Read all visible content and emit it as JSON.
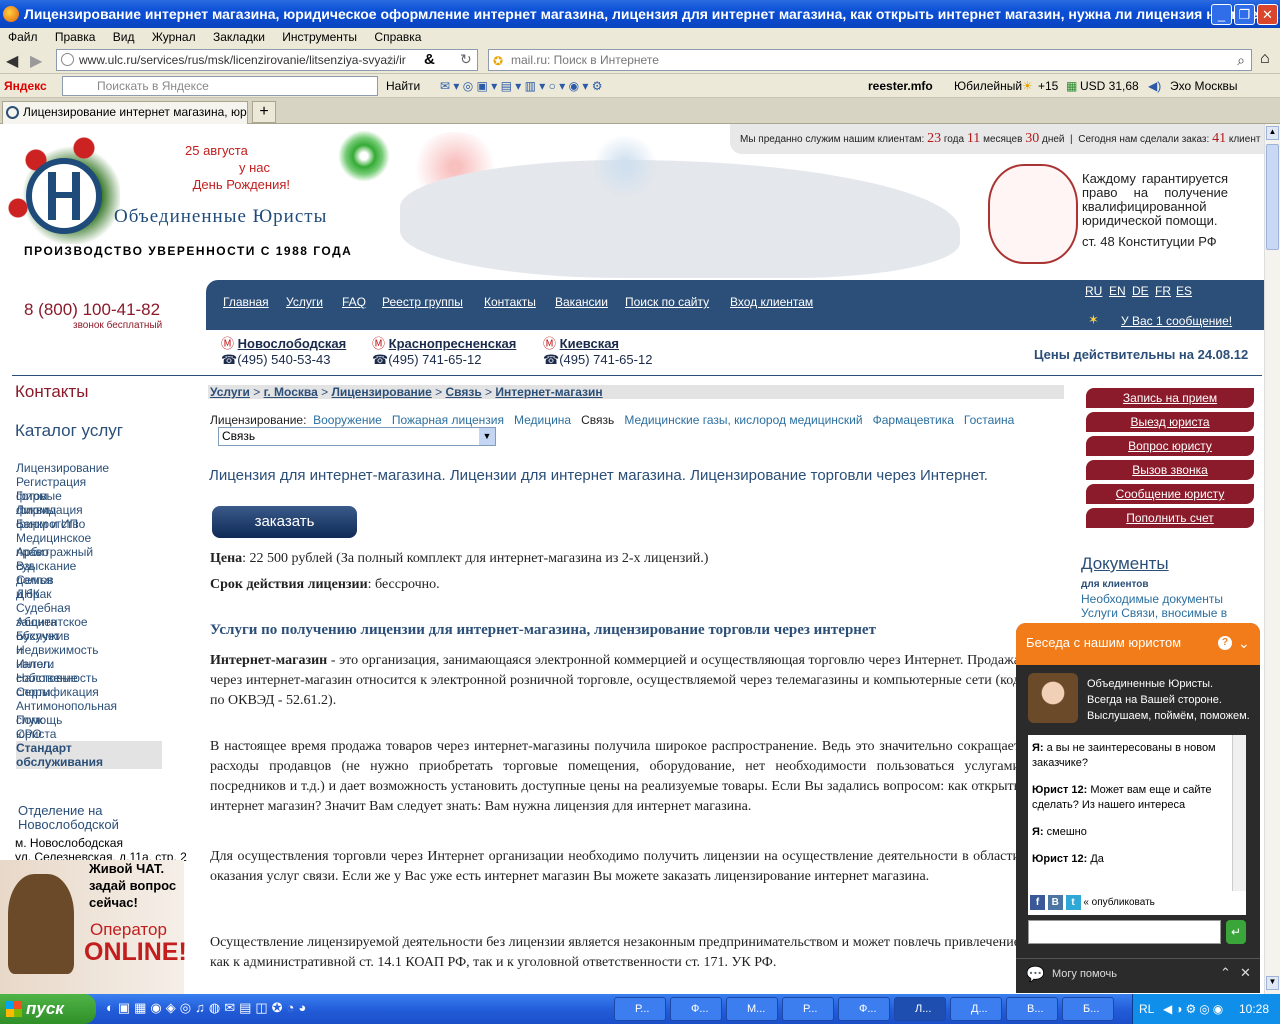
{
  "window": {
    "title": "Лицензирование интернет магазина, юридическое оформление интернет магазина, лицензия для интернет магазина, как открыть интернет магазин, нужна ли лицензия на интерн..."
  },
  "menu": [
    "Файл",
    "Правка",
    "Вид",
    "Журнал",
    "Закладки",
    "Инструменты",
    "Справка"
  ],
  "address": {
    "url": "www.ulc.ru/services/rus/msk/licenzirovanie/litsenziya-svyazi/ir",
    "search_placeholder": "mail.ru: Поиск в Интернете"
  },
  "yandex": {
    "logo": "Яндекс",
    "search_placeholder": "Поискать в Яндексе",
    "find": "Найти",
    "reester": "reester.mfo",
    "city": "Юбилейный",
    "weather": "+15",
    "usd": "USD 31,68",
    "radio": "Эхо Москвы"
  },
  "tab": {
    "title": "Лицензирование интернет магазина, юри..."
  },
  "header": {
    "birthday_line1": "25 августа",
    "birthday_line2": "у нас",
    "birthday_line3": "День Рождения!",
    "company": "Объединенные Юристы",
    "slogan": "ПРОИЗВОДСТВО УВЕРЕННОСТИ С 1988 ГОДА",
    "guarantee": "Каждому гарантируется право на получение квалифицированной юридической помощи.",
    "constitution": "ст. 48 Конституции РФ",
    "serve_text": "Мы преданно служим нашим клиентам:",
    "years": "23",
    "years_label": "года",
    "months": "11",
    "months_label": "месяцев",
    "days": "30",
    "days_label": "дней",
    "orders_text": "Сегодня нам сделали заказ:",
    "orders": "41",
    "orders_label": "клиент",
    "phone": "8 (800) 100-41-82",
    "phone_note": "звонок бесплатный"
  },
  "nav": [
    "Главная",
    "Услуги",
    "FAQ",
    "Реестр группы",
    "Контакты",
    "Вакансии",
    "Поиск по сайту",
    "Вход клиентам"
  ],
  "languages": [
    "RU",
    "EN",
    "DE",
    "FR",
    "ES"
  ],
  "message": "У Вас 1 сообщение!",
  "offices": [
    {
      "station": "Новослободская",
      "phone": "(495) 540-53-43"
    },
    {
      "station": "Краснопресненская",
      "phone": "(495) 741-65-12"
    },
    {
      "station": "Киевская",
      "phone": "(495) 741-65-12"
    }
  ],
  "prices_valid": "Цены действительны на 24.08.12",
  "sidebar": {
    "contacts": "Контакты",
    "catalog": "Каталог услуг",
    "items": [
      "Лицензирование",
      "Регистрация фирм",
      "Готовые фирмы",
      "Ликвидация фирм и ИП",
      "Банкротство",
      "Медицинское право",
      "Арбитражный суд",
      "Взыскание долгов",
      "Семья и брак",
      "ДНК",
      "Судебная защита",
      "Абонентское обслужив",
      "Бухучет и налоги",
      "Недвижимость",
      "Интел. собственность",
      "Налоговые споры",
      "Сертификация",
      "Антимонопольная служ",
      "Помощь юриста",
      "СРО",
      "Стандарт обслуживания"
    ],
    "office_title": "Отделение на Новослободской",
    "office_metro": "м. Новослободская",
    "office_addr": "ул. Селезневская, д.11а, стр. 2",
    "chat_promo1": "Живой ЧАТ.",
    "chat_promo2": "задай вопрос",
    "chat_promo3": "сейчас!",
    "operator": "Оператор",
    "online": "ONLINE!"
  },
  "breadcrumb": [
    "Услуги",
    "г. Москва",
    "Лицензирование",
    "Связь",
    "Интернет-магазин"
  ],
  "licensing": {
    "label": "Лицензирование:",
    "items": [
      "Вооружение",
      "Пожарная лицензия",
      "Медицина",
      "Связь",
      "Медицинские газы, кислород медицинский",
      "Фармацевтика",
      "Гостаина"
    ],
    "selected": "Связь"
  },
  "article": {
    "title": "Лицензия для интернет-магазина. Лицензии для интернет магазина. Лицензирование торговли через Интернет.",
    "order_btn": "заказать",
    "price_label": "Цена",
    "price": ": 22 500 рублей (За полный комплект для интернет-магазина из 2-х лицензий.)",
    "term_label": "Срок действия лицензии",
    "term": ": бессрочно.",
    "h2": "Услуги по получению лицензии для интернет-магазина,  лицензирование торговли через интернет",
    "p1_bold": "Интернет-магазин",
    "p1": " - это организация, занимающаяся электронной коммерцией и осуществляющая торговлю через Интернет. Продажа через интернет-магазин относится к электронной розничной торговле, осуществляемой через телемагазины и компьютерные сети (код по ОКВЭД - 52.61.2).",
    "p2": "В настоящее время продажа товаров через интернет-магазины получила широкое распространение. Ведь это значительно сокращает расходы продавцов (не нужно приобретать торговые помещения, оборудование, нет необходимости пользоваться услугами посредников и т.д.) и дает возможность установить доступные цены на реализуемые товары. Если Вы задались вопросом: как открыть интернет магазин? Значит Вам следует знать: Вам нужна лицензия для интернет магазина.",
    "p3": "Для осуществления торговли через Интернет организации необходимо получить лицензии на осуществление деятельности в области оказания услуг связи. Если же у Вас уже есть интернет магазин Вы можете заказать лицензирование интернет магазина.",
    "p4": "Осуществление лицензируемой деятельности без лицензии является незаконным предпринимательством и может повлечь привлечение как к административной ст. 14.1 КОАП РФ, так и к уголовной ответственности ст. 171. УК РФ."
  },
  "right_buttons": [
    "Запись на прием",
    "Выезд юриста",
    "Вопрос юристу",
    "Вызов звонка",
    "Сообщение юристу",
    "Пополнить счет"
  ],
  "documents": {
    "title": "Документы",
    "subtitle": "для клиентов",
    "items": [
      "Необходимые документы",
      "Услуги Связи, вносимые в"
    ]
  },
  "chat": {
    "header": "Беседа с нашим юристом",
    "intro1": "Объединенные Юристы.",
    "intro2": "Всегда на Вашей стороне.",
    "intro3": "Выслушаем, поймём, поможем.",
    "messages": [
      {
        "who": "Я:",
        "text": " а вы не заинтересованы в новом заказчике?"
      },
      {
        "who": "Юрист 12:",
        "text": " Может вам еще и сайте сделать? Из нашего интереса"
      },
      {
        "who": "Я:",
        "text": " смешно"
      },
      {
        "who": "Юрист 12:",
        "text": " Да"
      }
    ],
    "publish": "« опубликовать",
    "can_help": "Могу помочь"
  },
  "taskbar": {
    "start": "пуск",
    "items": [
      "Р...",
      "Ф...",
      "М...",
      "Р...",
      "Ф...",
      "Л...",
      "Д...",
      "В...",
      "Б..."
    ],
    "lang": "RL",
    "time": "10:28"
  },
  "colors": {
    "accent_blue": "#2b4f78",
    "accent_red": "#8b1a2a",
    "chat_orange": "#f27c1a"
  }
}
